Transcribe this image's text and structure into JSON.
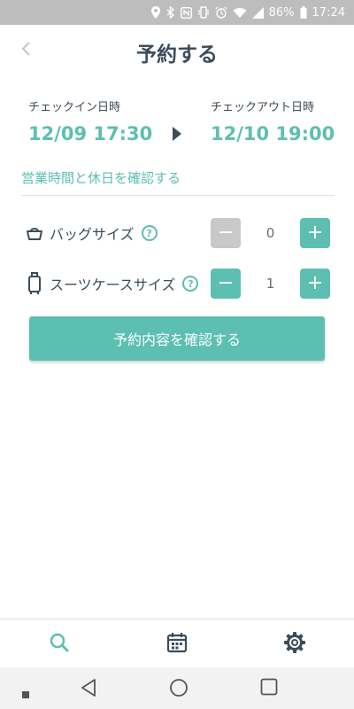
{
  "status_bar": {
    "battery": "86%",
    "time": "17:24"
  },
  "header": {
    "title": "予約する"
  },
  "checkin": {
    "label": "チェックイン日時",
    "value": "12/09 17:30"
  },
  "checkout": {
    "label": "チェックアウト日時",
    "value": "12/10 19:00"
  },
  "hours_link": "営業時間と休日を確認する",
  "items": {
    "bag": {
      "label": "バッグサイズ",
      "quantity": "0",
      "help": "?"
    },
    "suitcase": {
      "label": "スーツケースサイズ",
      "quantity": "1",
      "help": "?"
    }
  },
  "stepper": {
    "minus": "−",
    "plus": "+"
  },
  "confirm_button": "予約内容を確認する",
  "colors": {
    "accent": "#5cbfb1",
    "title": "#3b4d5c",
    "disabled": "#c9c9c9"
  },
  "bottom_nav": [
    "search-icon",
    "calendar-icon",
    "gear-icon"
  ]
}
